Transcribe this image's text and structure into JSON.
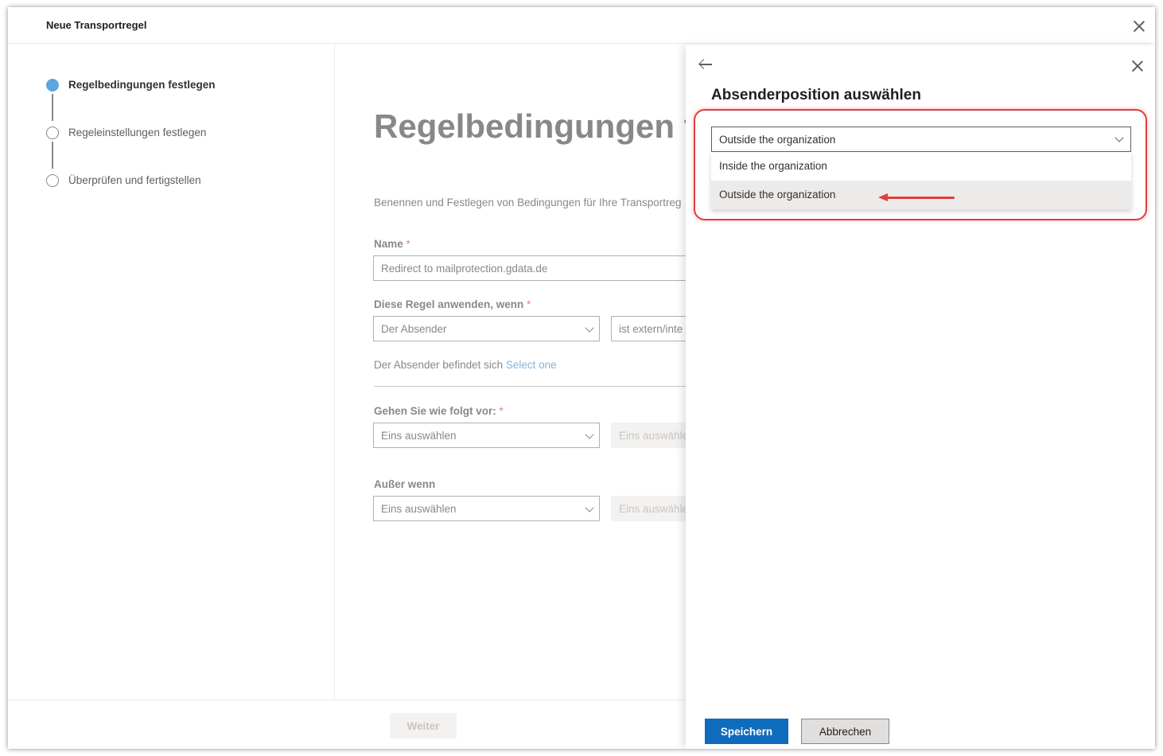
{
  "window": {
    "title": "Neue Transportregel"
  },
  "steps": [
    {
      "label": "Regelbedingungen festlegen",
      "state": "active"
    },
    {
      "label": "Regeleinstellungen festlegen",
      "state": "pending"
    },
    {
      "label": "Überprüfen und fertigstellen",
      "state": "pending"
    }
  ],
  "main": {
    "heading": "Regelbedingungen f",
    "description": "Benennen und Festlegen von Bedingungen für Ihre Transportreg",
    "name_label": "Name",
    "name_value": "Redirect to mailprotection.gdata.de",
    "apply_label": "Diese Regel anwenden, wenn",
    "apply_select": "Der Absender",
    "apply_select2": "ist extern/inte",
    "hint_text": "Der Absender befindet sich",
    "hint_link": "Select one",
    "action_label": "Gehen Sie wie folgt vor:",
    "action_select": "Eins auswählen",
    "action_select2": "Eins auswähle",
    "except_label": "Außer wenn",
    "except_select": "Eins auswählen",
    "except_select2": "Eins auswähle",
    "required_mark": "*"
  },
  "footer": {
    "next_label": "Weiter"
  },
  "flyout": {
    "title": "Absenderposition auswählen",
    "dropdown_value": "Outside the organization",
    "options": [
      {
        "label": "Inside the organization",
        "selected": false
      },
      {
        "label": "Outside the organization",
        "selected": true
      }
    ],
    "save_label": "Speichern",
    "cancel_label": "Abbrechen"
  },
  "colors": {
    "accent": "#0f6cbd",
    "step_active": "#5ea5e0",
    "annotation": "#e03c40"
  }
}
